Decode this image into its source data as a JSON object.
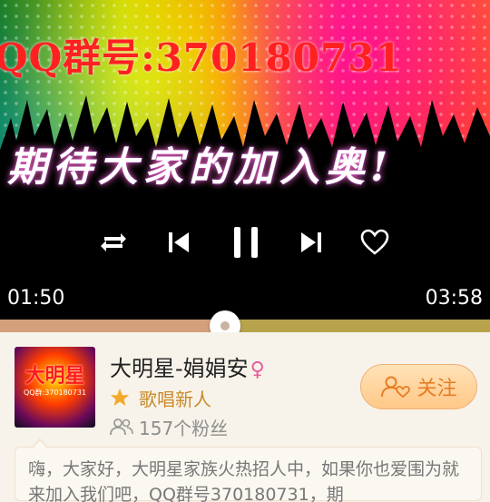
{
  "banner": {
    "qq_text": "QQ群号:370180731",
    "slogan": "期待大家的加入奥!"
  },
  "player": {
    "controls": {
      "repeat": "repeat-icon",
      "previous": "skip-previous-icon",
      "play_pause": "pause-icon",
      "next": "skip-next-icon",
      "favorite": "heart-icon"
    },
    "elapsed": "01:50",
    "duration": "03:58",
    "progress": 0.46
  },
  "profile": {
    "avatar_text": "大明星",
    "avatar_subtext": "QQ群:370180731",
    "name": "大明星-娟娟安",
    "gender_symbol": "♀",
    "level": "歌唱新人",
    "fans": "157个粉丝",
    "follow_label": "关注"
  },
  "intro": {
    "text": "嗨，大家好，大明星家族火热招人中，如果你也爱围为就来加入我们吧，QQ群号370180731，期"
  },
  "colors": {
    "accent": "#e87d24",
    "level": "#c88a2a",
    "gender": "#e85a9a",
    "progress_played": "#d4a07b",
    "progress_remaining": "#b8a34d"
  }
}
